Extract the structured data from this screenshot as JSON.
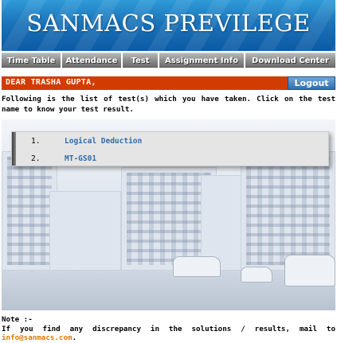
{
  "header": {
    "title": "SANMACS PREVILEGE"
  },
  "nav": {
    "items": [
      {
        "label": "Time Table"
      },
      {
        "label": "Attendance"
      },
      {
        "label": "Test"
      },
      {
        "label": "Assignment Info"
      },
      {
        "label": "Download Center"
      }
    ]
  },
  "greeting": {
    "text": "DEAR TRASHA GUPTA,"
  },
  "logout": {
    "label": "Logout"
  },
  "intro": {
    "text": "Following is the list of test(s) which you have taken. Click on the test name to know your test result."
  },
  "tests": [
    {
      "num": "1.",
      "name": "Logical Deduction"
    },
    {
      "num": "2.",
      "name": "MT-GS01"
    }
  ],
  "note": {
    "heading": "Note :-",
    "body": "If you find any discrepancy in the solutions / results, mail to",
    "email": "info@sanmacs.com",
    "end": "."
  },
  "colors": {
    "banner": "#1b73b9",
    "greeting_bar": "#d23c00",
    "link": "#2f6ca8",
    "email": "#e07a00"
  }
}
